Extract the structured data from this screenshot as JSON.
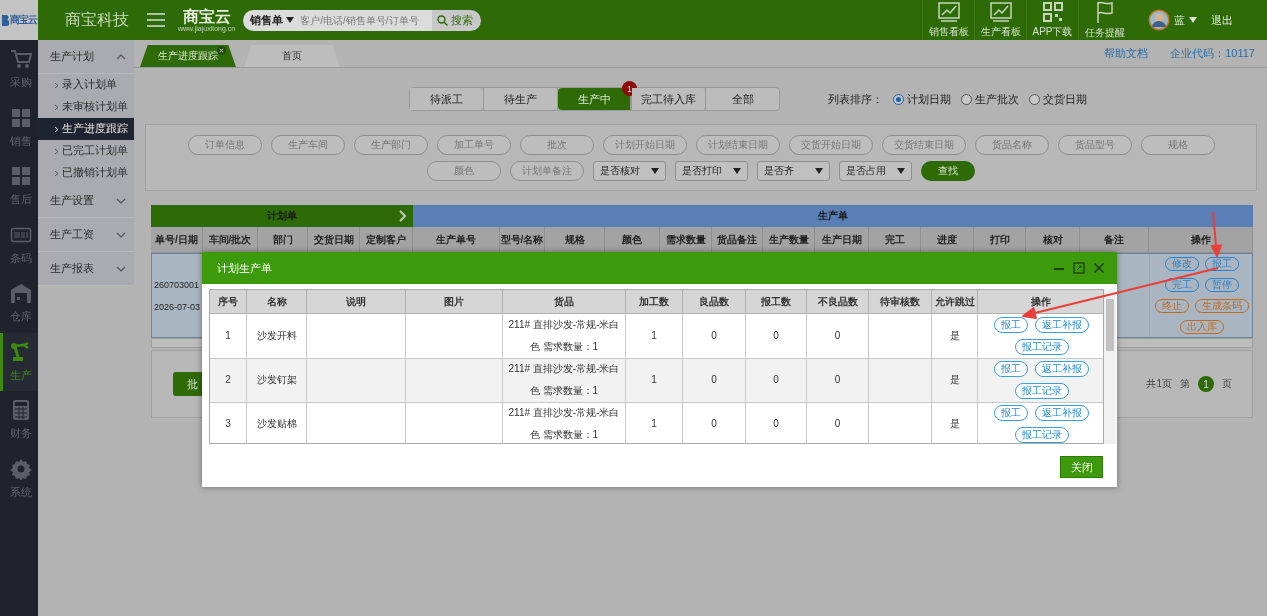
{
  "corner_logo": {
    "text": "商宝云"
  },
  "top_bar": {
    "brand": "商宝科技",
    "logo": "商宝云",
    "logo_url": "www.jiajuxitong.cn",
    "search": {
      "doc_type": "销售单",
      "placeholder": "客户/电话/销售单号/订单号",
      "button": "搜索"
    },
    "actions": [
      {
        "label": "销售看板",
        "kind": "chart"
      },
      {
        "label": "生产看板",
        "kind": "chart"
      },
      {
        "label": "APP下载",
        "kind": "qr"
      },
      {
        "label": "任务提醒",
        "kind": "flag"
      }
    ],
    "user": {
      "name": "蓝",
      "logout": "退出"
    }
  },
  "nav_rail": [
    {
      "label": "采购",
      "kind": "cart",
      "selected": false
    },
    {
      "label": "销售",
      "kind": "boxes",
      "selected": false
    },
    {
      "label": "售后",
      "kind": "boxes",
      "selected": false
    },
    {
      "label": "条码",
      "kind": "barcode",
      "selected": false
    },
    {
      "label": "仓库",
      "kind": "warehouse",
      "selected": false
    },
    {
      "label": "生产",
      "kind": "robot",
      "selected": true
    },
    {
      "label": "财务",
      "kind": "calculator",
      "selected": false
    },
    {
      "label": "系统",
      "kind": "gear",
      "selected": false
    }
  ],
  "sidebar": [
    {
      "label": "生产计划",
      "expanded": true,
      "children": [
        {
          "label": "录入计划单",
          "selected": false
        },
        {
          "label": "未审核计划单",
          "selected": false
        },
        {
          "label": "生产进度跟踪",
          "selected": true
        },
        {
          "label": "已完工计划单",
          "selected": false
        },
        {
          "label": "已撤销计划单",
          "selected": false
        }
      ]
    },
    {
      "label": "生产设置",
      "expanded": false
    },
    {
      "label": "生产工资",
      "expanded": false
    },
    {
      "label": "生产报表",
      "expanded": false
    }
  ],
  "page_tabs": [
    {
      "label": "生产进度跟踪",
      "selected": true,
      "closable": true
    },
    {
      "label": "首页",
      "selected": false,
      "closable": false
    }
  ],
  "help_link": "帮助文档",
  "company_code": "企业代码：10117",
  "status_tabs": [
    {
      "label": "待派工",
      "selected": false
    },
    {
      "label": "待生产",
      "selected": false
    },
    {
      "label": "生产中",
      "selected": true,
      "badge": "1"
    },
    {
      "label": "完工待入库",
      "selected": false
    },
    {
      "label": "全部",
      "selected": false
    }
  ],
  "sort": {
    "label": "列表排序：",
    "options": [
      {
        "label": "计划日期",
        "selected": true
      },
      {
        "label": "生产批次",
        "selected": false
      },
      {
        "label": "交货日期",
        "selected": false
      }
    ]
  },
  "filters": {
    "fields": [
      {
        "placeholder": "订单信息"
      },
      {
        "placeholder": "生产车间"
      },
      {
        "placeholder": "生产部门"
      },
      {
        "placeholder": "加工单号"
      },
      {
        "placeholder": "批次"
      },
      {
        "placeholder": "计划开始日期"
      },
      {
        "placeholder": "计划结束日期"
      },
      {
        "placeholder": "交货开始日期"
      },
      {
        "placeholder": "交货结束日期"
      },
      {
        "placeholder": "货品名称"
      },
      {
        "placeholder": "货品型号"
      },
      {
        "placeholder": "规格"
      }
    ],
    "more_fields": [
      {
        "placeholder": "颜色"
      },
      {
        "placeholder": "计划单备注"
      }
    ],
    "dropdowns": [
      "是否核对",
      "是否打印",
      "是否齐",
      "是否占用"
    ],
    "button": "查找"
  },
  "plan_table": {
    "groups": [
      {
        "label": "计划单",
        "kind": "plan"
      },
      {
        "label": "生产单",
        "kind": "production"
      }
    ],
    "columns": [
      "单号/日期",
      "车间/批次",
      "部门",
      "交货日期",
      "定制客户",
      "生产单号",
      "型号/名称",
      "规格",
      "颜色",
      "需求数量",
      "货品备注",
      "生产数量",
      "生产日期",
      "完工",
      "进度",
      "打印",
      "核对",
      "备注",
      "操作"
    ],
    "row": {
      "number": "260703001",
      "date": "2026-07-03",
      "actions": [
        {
          "label": "修改",
          "color": "#2f7fc4"
        },
        {
          "label": "报工",
          "color": "#2f7fc4"
        },
        {
          "label": "完工",
          "color": "#2f7fc4"
        },
        {
          "label": "暂停",
          "color": "#2f7fc4"
        },
        {
          "label": "终止",
          "color": "#c26a1e"
        },
        {
          "label": "生成条码",
          "color": "#c26a1e"
        },
        {
          "label": "出入库",
          "color": "#c26a1e"
        }
      ]
    }
  },
  "batch_button": "批",
  "pagination": {
    "total": "共1页",
    "prefix": "第",
    "page": "1",
    "suffix": "页"
  },
  "modal": {
    "title": "计划生产单",
    "columns": [
      "序号",
      "名称",
      "说明",
      "图片",
      "货品",
      "加工数",
      "良品数",
      "报工数",
      "不良品数",
      "待审核数",
      "允许跳过",
      "操作"
    ],
    "rows": [
      {
        "index": "1",
        "name": "沙发开料",
        "goods": "211# 直排沙发-常规-米白色 需求数量：1",
        "process_qty": "1",
        "good_qty": "0",
        "reported_qty": "0",
        "defect_qty": "0",
        "skip_allowed": "是",
        "actions": [
          "报工",
          "返工补报",
          "报工记录"
        ]
      },
      {
        "index": "2",
        "name": "沙发钉架",
        "goods": "211# 直排沙发-常规-米白色 需求数量：1",
        "process_qty": "1",
        "good_qty": "0",
        "reported_qty": "0",
        "defect_qty": "0",
        "skip_allowed": "是",
        "actions": [
          "报工",
          "返工补报",
          "报工记录"
        ]
      },
      {
        "index": "3",
        "name": "沙发贴棉",
        "goods": "211# 直排沙发-常规-米白色 需求数量：1",
        "process_qty": "1",
        "good_qty": "0",
        "reported_qty": "0",
        "defect_qty": "0",
        "skip_allowed": "是",
        "actions": [
          "报工",
          "返工补报",
          "报工记录"
        ]
      }
    ],
    "close_button": "关闭"
  }
}
